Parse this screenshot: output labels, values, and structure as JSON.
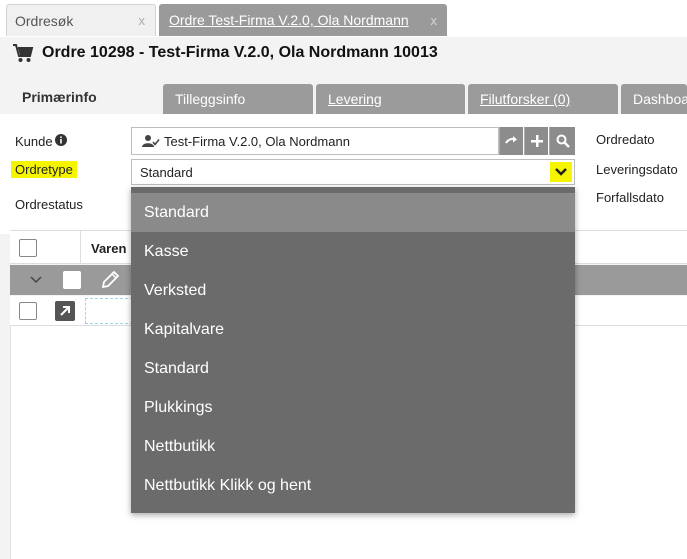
{
  "doc_tabs": [
    {
      "label": "Ordresøk",
      "close": "x"
    },
    {
      "label": "Ordre Test-Firma V.2.0, Ola Nordmann",
      "close": "x"
    }
  ],
  "order": {
    "title": "Ordre 10298 - Test-Firma V.2.0, Ola Nordmann 10013",
    "icon": "cart-icon"
  },
  "section_tabs": [
    {
      "label": "Primærinfo"
    },
    {
      "label": "Tilleggsinfo"
    },
    {
      "label": "Levering"
    },
    {
      "label": "Filutforsker (0)"
    },
    {
      "label": "Dashboa"
    }
  ],
  "form": {
    "kunde_label": "Kunde",
    "kunde_value": "Test-Firma V.2.0, Ola Nordmann",
    "ordretype_label": "Ordretype",
    "ordretype_value": "Standard",
    "ordrestatus_label": "Ordrestatus",
    "ordredato_label": "Ordredato",
    "leveringsdato_label": "Leveringsdato",
    "forfallsdato_label": "Forfallsdato"
  },
  "table": {
    "col_varenr": "Varen"
  },
  "dropdown": {
    "options": [
      "Standard",
      "Kasse",
      "Verksted",
      "Kapitalvare",
      "Standard",
      "Plukkings",
      "Nettbutikk",
      "Nettbutikk Klikk og hent"
    ],
    "selected_index": 0
  },
  "colors": {
    "highlight": "#f5f500",
    "tab_gray": "#9b9b9b",
    "dropdown_bg": "#6b6b6b",
    "dropdown_selected": "#8a8a8a"
  }
}
